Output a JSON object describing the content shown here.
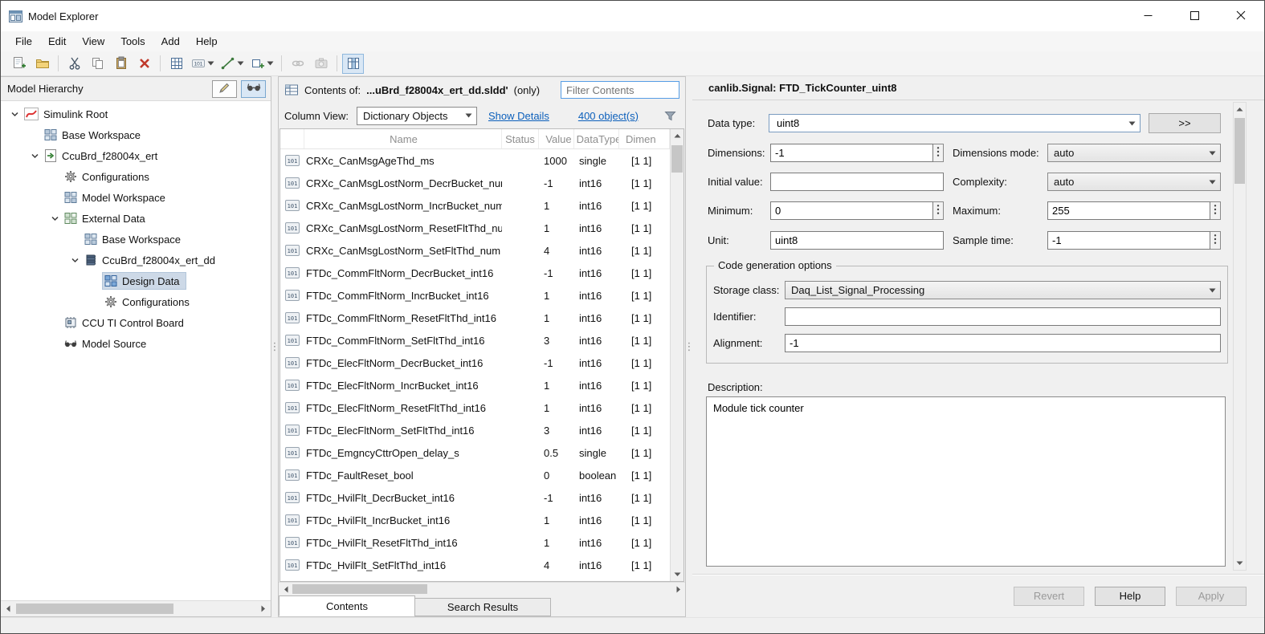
{
  "window": {
    "title": "Model Explorer"
  },
  "menu": {
    "items": [
      "File",
      "Edit",
      "View",
      "Tools",
      "Add",
      "Help"
    ]
  },
  "toolbar": {
    "icons": [
      {
        "name": "add-item-icon"
      },
      {
        "name": "open-folder-icon"
      },
      {
        "name": "cut-icon"
      },
      {
        "name": "copy-icon"
      },
      {
        "name": "paste-icon"
      },
      {
        "name": "delete-icon"
      },
      {
        "name": "grid-icon"
      },
      {
        "name": "data-object-icon",
        "dropdown": true
      },
      {
        "name": "line-style-icon",
        "dropdown": true
      },
      {
        "name": "new-subgroup-icon",
        "dropdown": true
      },
      {
        "name": "link-icon",
        "disabled": true
      },
      {
        "name": "snapshot-icon",
        "disabled": true
      },
      {
        "name": "column-view-icon",
        "active": true
      }
    ]
  },
  "hierarchy": {
    "title": "Model Hierarchy",
    "tree": [
      {
        "label": "Simulink Root",
        "level": 0,
        "expanded": true,
        "icon": "simulink-root-icon"
      },
      {
        "label": "Base Workspace",
        "level": 1,
        "icon": "workspace-icon"
      },
      {
        "label": "CcuBrd_f28004x_ert",
        "level": 1,
        "expanded": true,
        "icon": "model-icon"
      },
      {
        "label": "Configurations",
        "level": 2,
        "icon": "configurations-icon"
      },
      {
        "label": "Model Workspace",
        "level": 2,
        "icon": "workspace-icon"
      },
      {
        "label": "External Data",
        "level": 2,
        "expanded": true,
        "icon": "external-data-icon"
      },
      {
        "label": "Base Workspace",
        "level": 3,
        "icon": "workspace-icon"
      },
      {
        "label": "CcuBrd_f28004x_ert_dd",
        "level": 3,
        "expanded": true,
        "icon": "dictionary-icon"
      },
      {
        "label": "Design Data",
        "level": 4,
        "selected": true,
        "icon": "design-data-icon"
      },
      {
        "label": "Configurations",
        "level": 4,
        "icon": "configurations-icon"
      },
      {
        "label": "CCU TI Control Board",
        "level": 2,
        "icon": "control-board-icon"
      },
      {
        "label": "Model Source",
        "level": 2,
        "icon": "model-source-icon"
      }
    ]
  },
  "contents": {
    "header": {
      "label": "Contents of:",
      "path": "...uBrd_f28004x_ert_dd.sldd'",
      "suffix": "(only)",
      "filter_placeholder": "Filter Contents"
    },
    "controls": {
      "column_view_label": "Column View:",
      "column_view_value": "Dictionary Objects",
      "show_details": "Show Details",
      "object_count": "400 object(s)"
    },
    "table": {
      "row_icon": "data-row-icon",
      "columns": [
        "Name",
        "Status",
        "Value",
        "DataType",
        "Dimen"
      ],
      "rows": [
        {
          "name": "CRXc_CanMsgAgeThd_ms",
          "status": "",
          "value": "1000",
          "datatype": "single",
          "dimensions": "[1 1]"
        },
        {
          "name": "CRXc_CanMsgLostNorm_DecrBucket_num",
          "status": "",
          "value": "-1",
          "datatype": "int16",
          "dimensions": "[1 1]"
        },
        {
          "name": "CRXc_CanMsgLostNorm_IncrBucket_num",
          "status": "",
          "value": "1",
          "datatype": "int16",
          "dimensions": "[1 1]"
        },
        {
          "name": "CRXc_CanMsgLostNorm_ResetFltThd_num",
          "status": "",
          "value": "1",
          "datatype": "int16",
          "dimensions": "[1 1]"
        },
        {
          "name": "CRXc_CanMsgLostNorm_SetFltThd_num",
          "status": "",
          "value": "4",
          "datatype": "int16",
          "dimensions": "[1 1]"
        },
        {
          "name": "FTDc_CommFltNorm_DecrBucket_int16",
          "status": "",
          "value": "-1",
          "datatype": "int16",
          "dimensions": "[1 1]"
        },
        {
          "name": "FTDc_CommFltNorm_IncrBucket_int16",
          "status": "",
          "value": "1",
          "datatype": "int16",
          "dimensions": "[1 1]"
        },
        {
          "name": "FTDc_CommFltNorm_ResetFltThd_int16",
          "status": "",
          "value": "1",
          "datatype": "int16",
          "dimensions": "[1 1]"
        },
        {
          "name": "FTDc_CommFltNorm_SetFltThd_int16",
          "status": "",
          "value": "3",
          "datatype": "int16",
          "dimensions": "[1 1]"
        },
        {
          "name": "FTDc_ElecFltNorm_DecrBucket_int16",
          "status": "",
          "value": "-1",
          "datatype": "int16",
          "dimensions": "[1 1]"
        },
        {
          "name": "FTDc_ElecFltNorm_IncrBucket_int16",
          "status": "",
          "value": "1",
          "datatype": "int16",
          "dimensions": "[1 1]"
        },
        {
          "name": "FTDc_ElecFltNorm_ResetFltThd_int16",
          "status": "",
          "value": "1",
          "datatype": "int16",
          "dimensions": "[1 1]"
        },
        {
          "name": "FTDc_ElecFltNorm_SetFltThd_int16",
          "status": "",
          "value": "3",
          "datatype": "int16",
          "dimensions": "[1 1]"
        },
        {
          "name": "FTDc_EmgncyCttrOpen_delay_s",
          "status": "",
          "value": "0.5",
          "datatype": "single",
          "dimensions": "[1 1]"
        },
        {
          "name": "FTDc_FaultReset_bool",
          "status": "",
          "value": "0",
          "datatype": "boolean",
          "dimensions": "[1 1]"
        },
        {
          "name": "FTDc_HvilFlt_DecrBucket_int16",
          "status": "",
          "value": "-1",
          "datatype": "int16",
          "dimensions": "[1 1]"
        },
        {
          "name": "FTDc_HvilFlt_IncrBucket_int16",
          "status": "",
          "value": "1",
          "datatype": "int16",
          "dimensions": "[1 1]"
        },
        {
          "name": "FTDc_HvilFlt_ResetFltThd_int16",
          "status": "",
          "value": "1",
          "datatype": "int16",
          "dimensions": "[1 1]"
        },
        {
          "name": "FTDc_HvilFlt_SetFltThd_int16",
          "status": "",
          "value": "4",
          "datatype": "int16",
          "dimensions": "[1 1]"
        }
      ]
    },
    "tabs": [
      {
        "label": "Contents",
        "active": true
      },
      {
        "label": "Search Results",
        "active": false
      }
    ]
  },
  "dialog": {
    "title": "canlib.Signal: FTD_TickCounter_uint8",
    "data_type": {
      "label": "Data type:",
      "value": "uint8",
      "expand_button": ">>"
    },
    "dimensions": {
      "label": "Dimensions:",
      "value": "-1"
    },
    "dimensions_mode": {
      "label": "Dimensions mode:",
      "value": "auto"
    },
    "initial_value": {
      "label": "Initial value:",
      "value": ""
    },
    "complexity": {
      "label": "Complexity:",
      "value": "auto"
    },
    "minimum": {
      "label": "Minimum:",
      "value": "0"
    },
    "maximum": {
      "label": "Maximum:",
      "value": "255"
    },
    "unit": {
      "label": "Unit:",
      "value": "uint8"
    },
    "sample_time": {
      "label": "Sample time:",
      "value": "-1"
    },
    "code_gen": {
      "group_title": "Code generation options",
      "storage_class": {
        "label": "Storage class:",
        "value": "Daq_List_Signal_Processing"
      },
      "identifier": {
        "label": "Identifier:",
        "value": ""
      },
      "alignment": {
        "label": "Alignment:",
        "value": "-1"
      }
    },
    "description": {
      "label": "Description:",
      "value": "Module tick counter"
    },
    "buttons": [
      {
        "label": "Revert",
        "disabled": true
      },
      {
        "label": "Help",
        "disabled": false
      },
      {
        "label": "Apply",
        "disabled": true
      }
    ]
  },
  "colors": {
    "link_blue": "#0b5fbb",
    "tree_selection": "#cdd9e7",
    "toolbar_active": "#d9e7f5",
    "panel_bg": "#f0f0f0"
  }
}
